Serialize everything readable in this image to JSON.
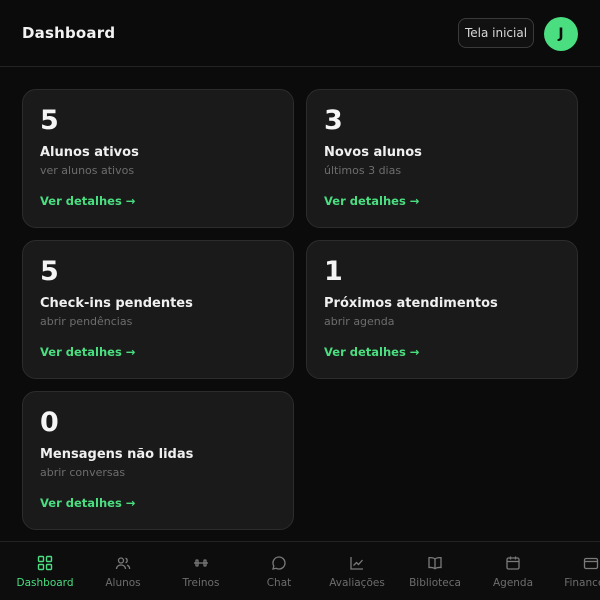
{
  "header": {
    "title": "Dashboard",
    "home_button": "Tela inicial",
    "avatar_initial": "J"
  },
  "cards": [
    {
      "value": "5",
      "label": "Alunos ativos",
      "subtitle": "ver alunos ativos",
      "link": "Ver detalhes →"
    },
    {
      "value": "3",
      "label": "Novos alunos",
      "subtitle": "últimos 3 dias",
      "link": "Ver detalhes →"
    },
    {
      "value": "5",
      "label": "Check-ins pendentes",
      "subtitle": "abrir pendências",
      "link": "Ver detalhes →"
    },
    {
      "value": "1",
      "label": "Próximos atendimentos",
      "subtitle": "abrir agenda",
      "link": "Ver detalhes →"
    },
    {
      "value": "0",
      "label": "Mensagens não lidas",
      "subtitle": "abrir conversas",
      "link": "Ver detalhes →"
    }
  ],
  "bottom_nav": [
    {
      "label": "Dashboard",
      "icon": "grid-icon",
      "active": true
    },
    {
      "label": "Alunos",
      "icon": "users-icon",
      "active": false
    },
    {
      "label": "Treinos",
      "icon": "dumbbell-icon",
      "active": false
    },
    {
      "label": "Chat",
      "icon": "chat-bubble-icon",
      "active": false
    },
    {
      "label": "Avaliações",
      "icon": "line-chart-icon",
      "active": false
    },
    {
      "label": "Biblioteca",
      "icon": "book-icon",
      "active": false
    },
    {
      "label": "Agenda",
      "icon": "calendar-icon",
      "active": false
    },
    {
      "label": "Financeiro",
      "icon": "wallet-icon",
      "active": false
    }
  ],
  "colors": {
    "accent": "#4ade80",
    "background": "#0b0b0b",
    "card": "#1a1a1a",
    "muted_text": "#6d6d6d"
  }
}
